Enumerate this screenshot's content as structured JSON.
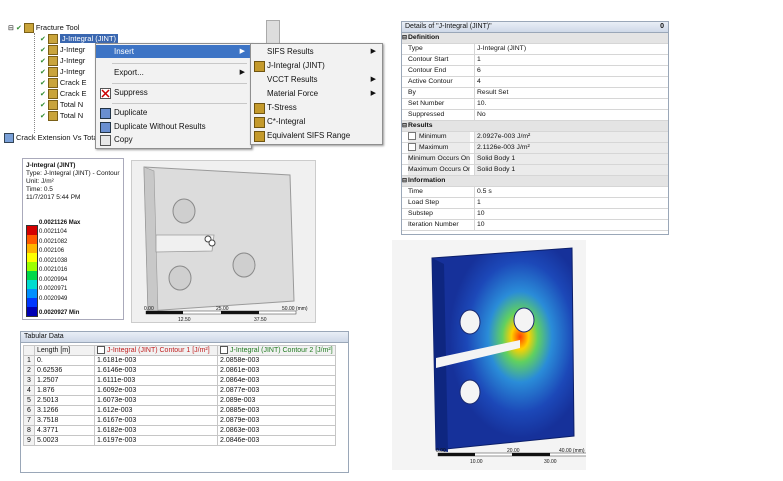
{
  "tree": {
    "root_label": "Fracture Tool",
    "items": [
      "J-Integral (JINT)",
      "J-Integral",
      "J-Integral",
      "J-Integral",
      "Crack Extension",
      "Crack Extension",
      "Total Number of Cycles",
      "Total Number of Cycles"
    ],
    "items_visible": [
      "J-Integral (JINT)",
      "J-Integr",
      "J-Integr",
      "J-Integr",
      "Crack E",
      "Crack E",
      "Total N",
      "Total N"
    ],
    "bottom_item": "Crack Extension Vs Tota"
  },
  "context_menu": {
    "items": [
      {
        "label": "Insert",
        "submenu": true,
        "highlighted": true
      },
      {
        "label": "Export...",
        "submenu": true
      },
      {
        "label": "Suppress",
        "icon": "suppress-icon"
      },
      {
        "label": "Duplicate",
        "icon": "duplicate-icon"
      },
      {
        "label": "Duplicate Without Results",
        "icon": "duplicate-icon"
      },
      {
        "label": "Copy",
        "icon": "copy-icon"
      }
    ]
  },
  "insert_submenu": {
    "items": [
      {
        "label": "SIFS Results",
        "submenu": true
      },
      {
        "label": "J-Integral (JINT)"
      },
      {
        "label": "VCCT Results",
        "submenu": true
      },
      {
        "label": "Material Force",
        "submenu": true
      },
      {
        "label": "T-Stress"
      },
      {
        "label": "C*-Integral"
      },
      {
        "label": "Equivalent SIFS Range"
      }
    ]
  },
  "details": {
    "title": "Details of \"J-Integral (JINT)\"",
    "pin": "0",
    "sections": [
      {
        "name": "Definition",
        "rows": [
          {
            "k": "Type",
            "v": "J-Integral (JINT)"
          },
          {
            "k": "Contour Start",
            "v": "1"
          },
          {
            "k": "Contour End",
            "v": "6"
          },
          {
            "k": "Active Contour",
            "v": "4"
          },
          {
            "k": "By",
            "v": "Result Set"
          },
          {
            "k": "Set Number",
            "v": "10."
          },
          {
            "k": "Suppressed",
            "v": "No"
          }
        ]
      },
      {
        "name": "Results",
        "rows": [
          {
            "k": "Minimum",
            "v": "2.0927e-003 J/m²",
            "check": true
          },
          {
            "k": "Maximum",
            "v": "2.1126e-003 J/m²",
            "check": true
          },
          {
            "k": "Minimum Occurs On",
            "v": "Solid Body 1"
          },
          {
            "k": "Maximum Occurs On",
            "v": "Solid Body 1"
          }
        ]
      },
      {
        "name": "Information",
        "rows": [
          {
            "k": "Time",
            "v": "0.5 s"
          },
          {
            "k": "Load Step",
            "v": "1"
          },
          {
            "k": "Substep",
            "v": "10"
          },
          {
            "k": "Iteration Number",
            "v": "10"
          }
        ]
      }
    ]
  },
  "legend": {
    "title": "J-Integral (JINT)",
    "type_line": "Type: J-Integral (JINT) - Contour",
    "unit_line": "Unit: J/m²",
    "time_line": "Time: 0.5",
    "date_line": "11/7/2017 5:44 PM",
    "max_label": "0.0021126 Max",
    "min_label": "0.0020927 Min",
    "levels": [
      "0.0021104",
      "0.0021082",
      "0.002106",
      "0.0021038",
      "0.0021016",
      "0.0020994",
      "0.0020971",
      "0.0020949"
    ],
    "colors": [
      "#d40000",
      "#ff5a00",
      "#ffb400",
      "#ffff00",
      "#9cff00",
      "#00d84a",
      "#00dcd0",
      "#0090ff",
      "#0038ff",
      "#0000b4"
    ]
  },
  "model_scale": {
    "left": "0.00",
    "mid1": "12.50",
    "mid2": "25.00",
    "mid3": "37.50",
    "right": "50.00 (mm)"
  },
  "contour_scale": {
    "left": "0.00",
    "mid1": "10.00",
    "mid2": "20.00",
    "mid3": "30.00",
    "right": "40.00 (mm)"
  },
  "tabular": {
    "title": "Tabular Data",
    "columns": [
      "Length [m]",
      "J-Integral (JINT) Contour 1 [J/m²]",
      "J-Integral (JINT) Contour 2 [J/m²]"
    ],
    "rows": [
      [
        "1",
        "0.",
        "1.6181e-003",
        "2.0858e-003"
      ],
      [
        "2",
        "0.62536",
        "1.6146e-003",
        "2.0861e-003"
      ],
      [
        "3",
        "1.2507",
        "1.6111e-003",
        "2.0864e-003"
      ],
      [
        "4",
        "1.876",
        "1.6092e-003",
        "2.0877e-003"
      ],
      [
        "5",
        "2.5013",
        "1.6073e-003",
        "2.089e-003"
      ],
      [
        "6",
        "3.1266",
        "1.612e-003",
        "2.0885e-003"
      ],
      [
        "7",
        "3.7518",
        "1.6167e-003",
        "2.0879e-003"
      ],
      [
        "8",
        "4.3771",
        "1.6182e-003",
        "2.0863e-003"
      ],
      [
        "9",
        "5.0023",
        "1.6197e-003",
        "2.0846e-003"
      ]
    ]
  }
}
